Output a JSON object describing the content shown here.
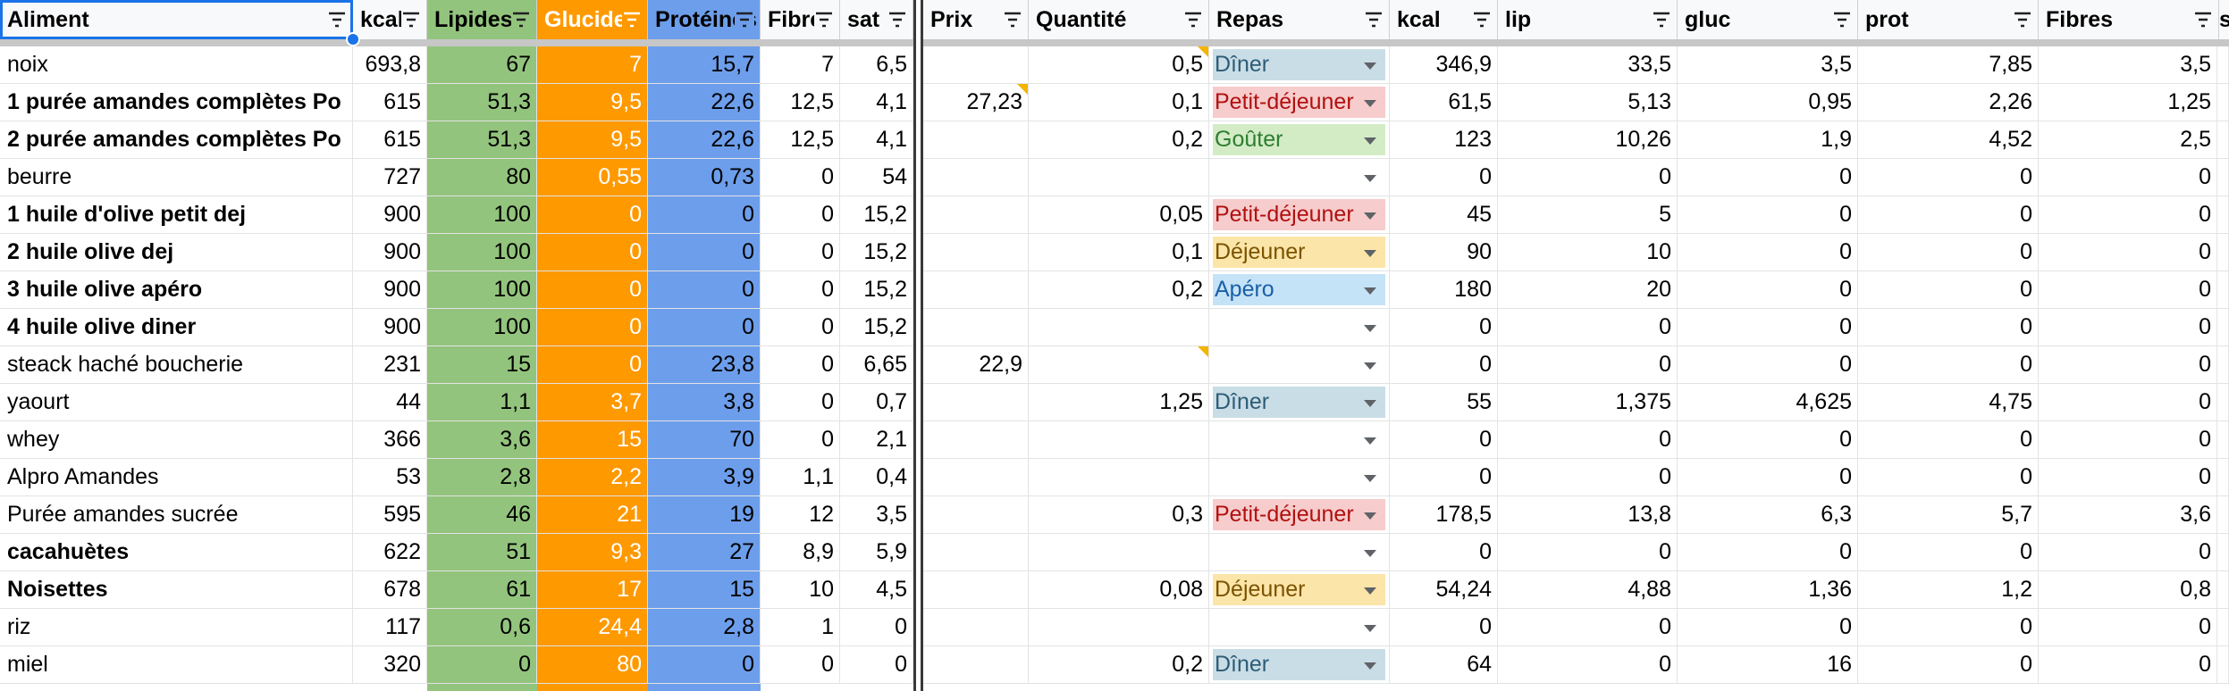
{
  "headers": {
    "left": [
      {
        "label": "Aliment"
      },
      {
        "label": "kcal"
      },
      {
        "label": "Lipides"
      },
      {
        "label": "Glucides"
      },
      {
        "label": "Protéines"
      },
      {
        "label": "Fibres"
      },
      {
        "label": "sat"
      }
    ],
    "right": [
      {
        "label": "Prix"
      },
      {
        "label": "Quantité"
      },
      {
        "label": "Repas"
      },
      {
        "label": "kcal"
      },
      {
        "label": "lip"
      },
      {
        "label": "gluc"
      },
      {
        "label": "prot"
      },
      {
        "label": "Fibres"
      },
      {
        "label": "s"
      }
    ]
  },
  "colors": {
    "lipides": "#93c47d",
    "glucides": "#ff9900",
    "proteines": "#6d9eeb",
    "selection": "#1a73e8"
  },
  "repas_styles": {
    "Dîner": {
      "bg": "#c9dde6",
      "fg": "#2d5c77"
    },
    "Petit-déjeuner": {
      "bg": "#f7cccc",
      "fg": "#b11010"
    },
    "Goûter": {
      "bg": "#d3ecc5",
      "fg": "#2e7d32"
    },
    "Déjeuner": {
      "bg": "#fce5a8",
      "fg": "#7a5300"
    },
    "Apéro": {
      "bg": "#c5e3f6",
      "fg": "#1a5fa8"
    }
  },
  "rows": [
    {
      "aliment": "noix",
      "bold": false,
      "kcal": "693,8",
      "lip": "67",
      "gluc": "7",
      "prot": "15,7",
      "fib": "7",
      "sat": "6,5",
      "prix": "",
      "prix_note": false,
      "qte": "0,5",
      "qte_note": true,
      "repas": "Dîner",
      "t_kcal": "346,9",
      "t_lip": "33,5",
      "t_gluc": "3,5",
      "t_prot": "7,85",
      "t_fib": "3,5"
    },
    {
      "aliment": "1 purée amandes complètes Po",
      "bold": true,
      "kcal": "615",
      "lip": "51,3",
      "gluc": "9,5",
      "prot": "22,6",
      "fib": "12,5",
      "sat": "4,1",
      "prix": "27,23",
      "prix_note": true,
      "qte": "0,1",
      "qte_note": false,
      "repas": "Petit-déjeuner",
      "t_kcal": "61,5",
      "t_lip": "5,13",
      "t_gluc": "0,95",
      "t_prot": "2,26",
      "t_fib": "1,25"
    },
    {
      "aliment": "2 purée amandes complètes Po",
      "bold": true,
      "kcal": "615",
      "lip": "51,3",
      "gluc": "9,5",
      "prot": "22,6",
      "fib": "12,5",
      "sat": "4,1",
      "prix": "",
      "prix_note": false,
      "qte": "0,2",
      "qte_note": false,
      "repas": "Goûter",
      "t_kcal": "123",
      "t_lip": "10,26",
      "t_gluc": "1,9",
      "t_prot": "4,52",
      "t_fib": "2,5"
    },
    {
      "aliment": "beurre",
      "bold": false,
      "kcal": "727",
      "lip": "80",
      "gluc": "0,55",
      "prot": "0,73",
      "fib": "0",
      "sat": "54",
      "prix": "",
      "prix_note": false,
      "qte": "",
      "qte_note": false,
      "repas": "",
      "t_kcal": "0",
      "t_lip": "0",
      "t_gluc": "0",
      "t_prot": "0",
      "t_fib": "0"
    },
    {
      "aliment": "1 huile d'olive petit dej",
      "bold": true,
      "kcal": "900",
      "lip": "100",
      "gluc": "0",
      "prot": "0",
      "fib": "0",
      "sat": "15,2",
      "prix": "",
      "prix_note": false,
      "qte": "0,05",
      "qte_note": false,
      "repas": "Petit-déjeuner",
      "t_kcal": "45",
      "t_lip": "5",
      "t_gluc": "0",
      "t_prot": "0",
      "t_fib": "0"
    },
    {
      "aliment": "2 huile olive dej",
      "bold": true,
      "kcal": "900",
      "lip": "100",
      "gluc": "0",
      "prot": "0",
      "fib": "0",
      "sat": "15,2",
      "prix": "",
      "prix_note": false,
      "qte": "0,1",
      "qte_note": false,
      "repas": "Déjeuner",
      "t_kcal": "90",
      "t_lip": "10",
      "t_gluc": "0",
      "t_prot": "0",
      "t_fib": "0"
    },
    {
      "aliment": "3 huile olive apéro",
      "bold": true,
      "kcal": "900",
      "lip": "100",
      "gluc": "0",
      "prot": "0",
      "fib": "0",
      "sat": "15,2",
      "prix": "",
      "prix_note": false,
      "qte": "0,2",
      "qte_note": false,
      "repas": "Apéro",
      "t_kcal": "180",
      "t_lip": "20",
      "t_gluc": "0",
      "t_prot": "0",
      "t_fib": "0"
    },
    {
      "aliment": "4 huile olive diner",
      "bold": true,
      "kcal": "900",
      "lip": "100",
      "gluc": "0",
      "prot": "0",
      "fib": "0",
      "sat": "15,2",
      "prix": "",
      "prix_note": false,
      "qte": "",
      "qte_note": false,
      "repas": "",
      "t_kcal": "0",
      "t_lip": "0",
      "t_gluc": "0",
      "t_prot": "0",
      "t_fib": "0"
    },
    {
      "aliment": "steack haché boucherie",
      "bold": false,
      "kcal": "231",
      "lip": "15",
      "gluc": "0",
      "prot": "23,8",
      "fib": "0",
      "sat": "6,65",
      "prix": "22,9",
      "prix_note": false,
      "qte": "",
      "qte_note": true,
      "repas": "",
      "t_kcal": "0",
      "t_lip": "0",
      "t_gluc": "0",
      "t_prot": "0",
      "t_fib": "0"
    },
    {
      "aliment": "yaourt",
      "bold": false,
      "kcal": "44",
      "lip": "1,1",
      "gluc": "3,7",
      "prot": "3,8",
      "fib": "0",
      "sat": "0,7",
      "prix": "",
      "prix_note": false,
      "qte": "1,25",
      "qte_note": false,
      "repas": "Dîner",
      "t_kcal": "55",
      "t_lip": "1,375",
      "t_gluc": "4,625",
      "t_prot": "4,75",
      "t_fib": "0"
    },
    {
      "aliment": "whey",
      "bold": false,
      "kcal": "366",
      "lip": "3,6",
      "gluc": "15",
      "prot": "70",
      "fib": "0",
      "sat": "2,1",
      "prix": "",
      "prix_note": false,
      "qte": "",
      "qte_note": false,
      "repas": "",
      "t_kcal": "0",
      "t_lip": "0",
      "t_gluc": "0",
      "t_prot": "0",
      "t_fib": "0"
    },
    {
      "aliment": "Alpro Amandes",
      "bold": false,
      "kcal": "53",
      "lip": "2,8",
      "gluc": "2,2",
      "prot": "3,9",
      "fib": "1,1",
      "sat": "0,4",
      "prix": "",
      "prix_note": false,
      "qte": "",
      "qte_note": false,
      "repas": "",
      "t_kcal": "0",
      "t_lip": "0",
      "t_gluc": "0",
      "t_prot": "0",
      "t_fib": "0"
    },
    {
      "aliment": "Purée amandes sucrée",
      "bold": false,
      "kcal": "595",
      "lip": "46",
      "gluc": "21",
      "prot": "19",
      "fib": "12",
      "sat": "3,5",
      "prix": "",
      "prix_note": false,
      "qte": "0,3",
      "qte_note": false,
      "repas": "Petit-déjeuner",
      "t_kcal": "178,5",
      "t_lip": "13,8",
      "t_gluc": "6,3",
      "t_prot": "5,7",
      "t_fib": "3,6"
    },
    {
      "aliment": "cacahuètes",
      "bold": true,
      "kcal": "622",
      "lip": "51",
      "gluc": "9,3",
      "prot": "27",
      "fib": "8,9",
      "sat": "5,9",
      "prix": "",
      "prix_note": false,
      "qte": "",
      "qte_note": false,
      "repas": "",
      "t_kcal": "0",
      "t_lip": "0",
      "t_gluc": "0",
      "t_prot": "0",
      "t_fib": "0"
    },
    {
      "aliment": "Noisettes",
      "bold": true,
      "kcal": "678",
      "lip": "61",
      "gluc": "17",
      "prot": "15",
      "fib": "10",
      "sat": "4,5",
      "prix": "",
      "prix_note": false,
      "qte": "0,08",
      "qte_note": false,
      "repas": "Déjeuner",
      "t_kcal": "54,24",
      "t_lip": "4,88",
      "t_gluc": "1,36",
      "t_prot": "1,2",
      "t_fib": "0,8"
    },
    {
      "aliment": "riz",
      "bold": false,
      "kcal": "117",
      "lip": "0,6",
      "gluc": "24,4",
      "prot": "2,8",
      "fib": "1",
      "sat": "0",
      "prix": "",
      "prix_note": false,
      "qte": "",
      "qte_note": false,
      "repas": "",
      "t_kcal": "0",
      "t_lip": "0",
      "t_gluc": "0",
      "t_prot": "0",
      "t_fib": "0"
    },
    {
      "aliment": "miel",
      "bold": false,
      "kcal": "320",
      "lip": "0",
      "gluc": "80",
      "prot": "0",
      "fib": "0",
      "sat": "0",
      "prix": "",
      "prix_note": false,
      "qte": "0,2",
      "qte_note": false,
      "repas": "Dîner",
      "t_kcal": "64",
      "t_lip": "0",
      "t_gluc": "16",
      "t_prot": "0",
      "t_fib": "0"
    }
  ]
}
